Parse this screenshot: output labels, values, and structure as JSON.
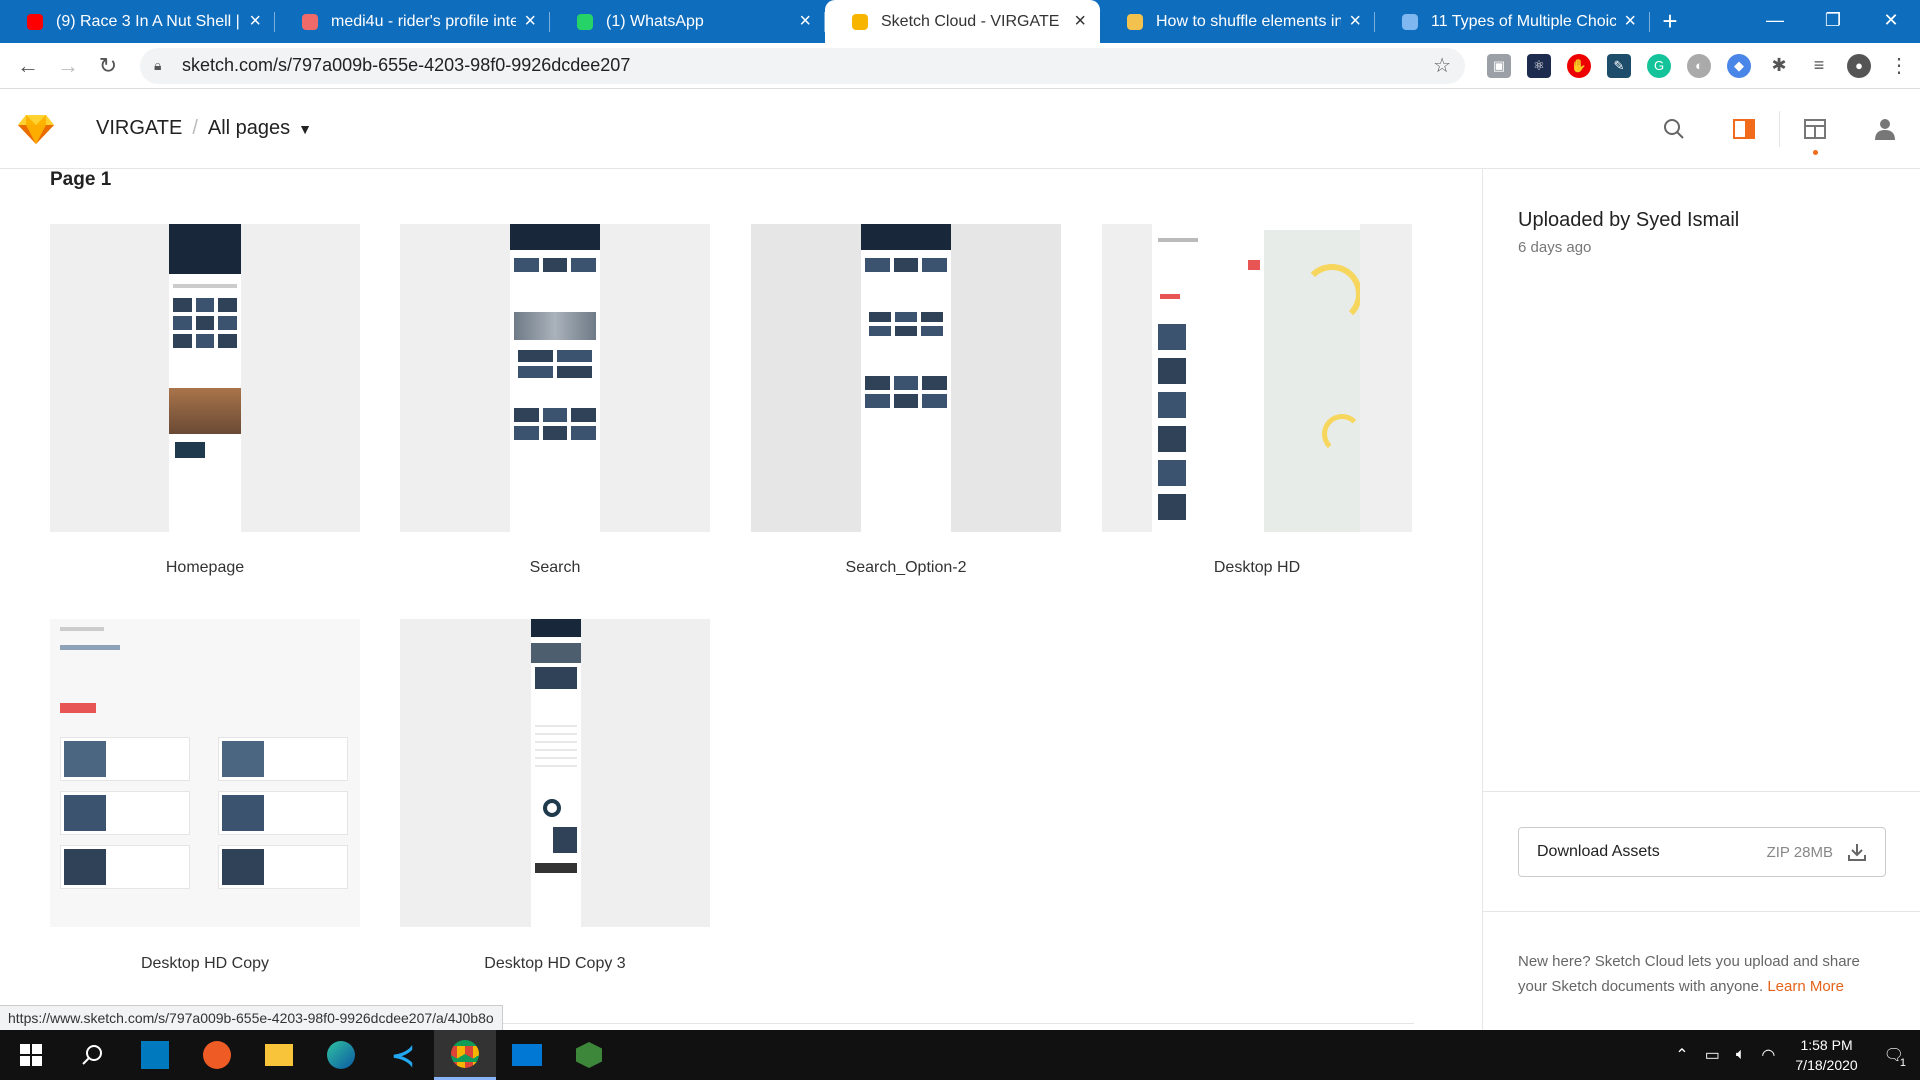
{
  "browser": {
    "tabs": [
      {
        "title": "(9) Race 3 In A Nut Shell | You",
        "favicon": "youtube-icon",
        "color": "#ff0000",
        "active": false
      },
      {
        "title": "medi4u - rider's profile integ",
        "favicon": "asana-icon",
        "color": "#f06a6a",
        "active": false
      },
      {
        "title": "(1) WhatsApp",
        "favicon": "whatsapp-icon",
        "color": "#25d366",
        "active": false
      },
      {
        "title": "Sketch Cloud - VIRGATE",
        "favicon": "sketch-icon",
        "color": "#f7b500",
        "active": true
      },
      {
        "title": "How to shuffle elements in a",
        "favicon": "codegrepper-icon",
        "color": "#f2c14e",
        "active": false
      },
      {
        "title": "11 Types of Multiple Choice",
        "favicon": "typeform-icon",
        "color": "#7fb7f0",
        "active": false
      }
    ],
    "new_tab": "+",
    "url": "sketch.com/s/797a009b-655e-4203-98f0-9926dcdee207",
    "status_url": "https://www.sketch.com/s/797a009b-655e-4203-98f0-9926dcdee207/a/4J0b8o"
  },
  "app": {
    "project": "VIRGATE",
    "separator": "/",
    "pages_label": "All pages",
    "page_title": "Page 1",
    "accent": "#f26a1b"
  },
  "artboards": [
    {
      "name": "Homepage"
    },
    {
      "name": "Search"
    },
    {
      "name": "Search_Option-2"
    },
    {
      "name": "Desktop HD"
    },
    {
      "name": "Desktop HD Copy"
    },
    {
      "name": "Desktop HD Copy 3"
    }
  ],
  "sidebar": {
    "uploaded_by": "Uploaded by Syed Ismail",
    "uploaded_ago": "6 days ago",
    "download_label": "Download Assets",
    "download_meta": "ZIP 28MB",
    "new_here_text": "New here? Sketch Cloud lets you upload and share your Sketch documents with anyone.",
    "learn_more": "Learn More"
  },
  "taskbar": {
    "time": "1:58 PM",
    "date": "7/18/2020",
    "notifications": "1"
  }
}
